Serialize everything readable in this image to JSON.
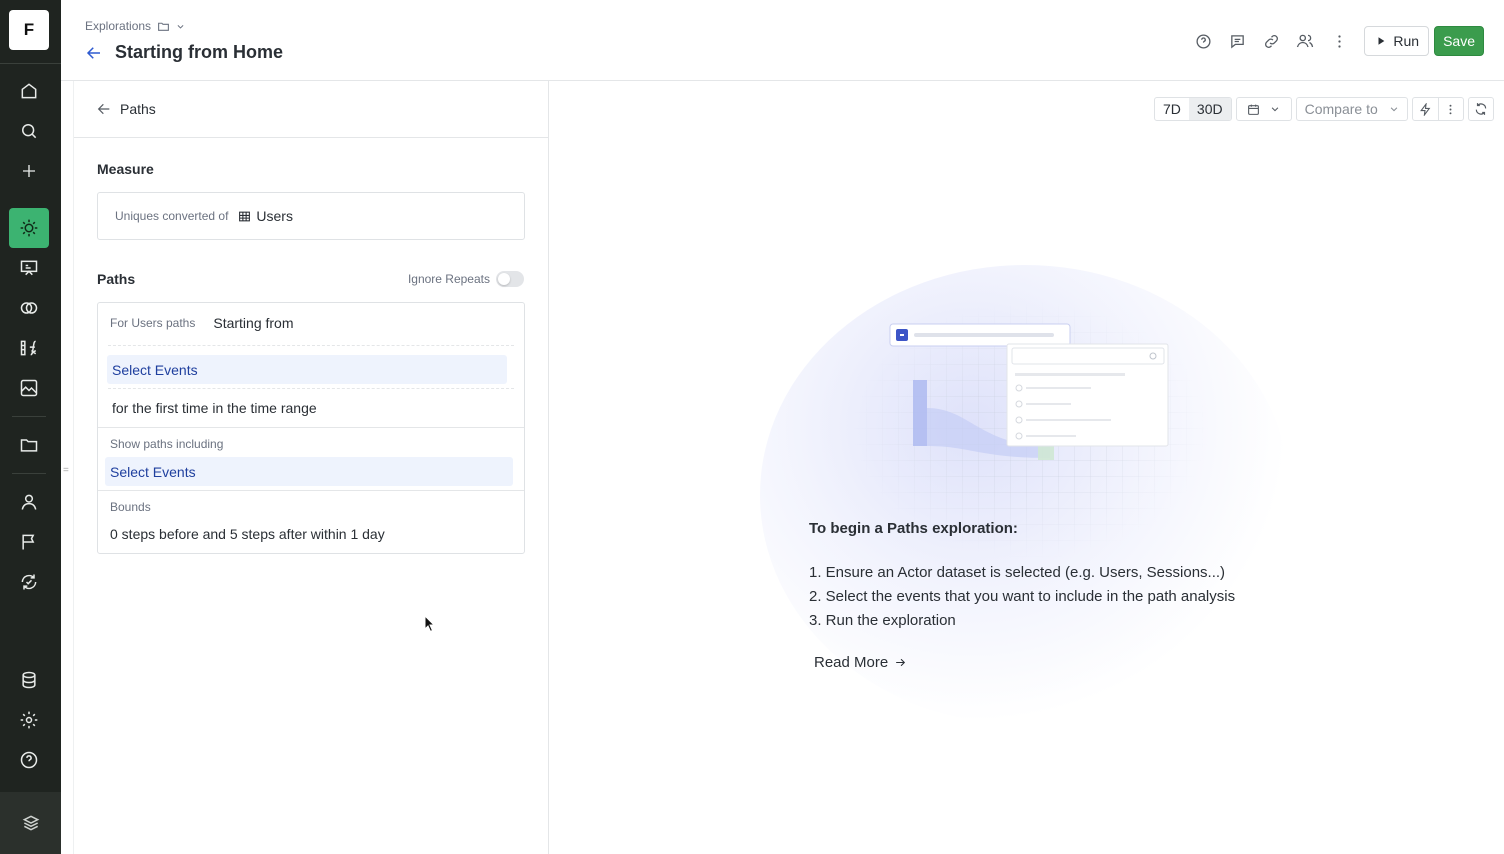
{
  "logo": {
    "letter": "F"
  },
  "sidebar": {
    "items": [
      {
        "name": "home-icon"
      },
      {
        "name": "search-icon"
      },
      {
        "name": "plus-icon"
      },
      {
        "name": "lightbulb-icon",
        "active": true
      },
      {
        "name": "presentation-icon"
      },
      {
        "name": "overlap-circles-icon"
      },
      {
        "name": "formula-icon"
      },
      {
        "name": "image-chart-icon"
      },
      {
        "name": "folder-icon"
      },
      {
        "name": "user-icon"
      },
      {
        "name": "flag-icon"
      },
      {
        "name": "experiment-icon"
      },
      {
        "name": "database-icon"
      },
      {
        "name": "gear-icon"
      },
      {
        "name": "help-icon"
      },
      {
        "name": "brand-stack-icon"
      }
    ],
    "accent": "#3cb371"
  },
  "header": {
    "breadcrumb": "Explorations",
    "title": "Starting from Home",
    "actions": {
      "run_label": "Run",
      "save_label": "Save"
    },
    "save_color": "#3b9c4d"
  },
  "panel": {
    "back_label": "Paths",
    "measure": {
      "heading": "Measure",
      "prefix": "Uniques converted of",
      "dataset": "Users"
    },
    "paths": {
      "heading": "Paths",
      "ignore_repeats_label": "Ignore Repeats",
      "ignore_repeats_on": false,
      "for_label": "For Users paths",
      "starting_label": "Starting from",
      "select_events_1": "Select Events",
      "first_time_text": "for the first time in the time range",
      "show_paths_label": "Show paths including",
      "select_events_2": "Select Events",
      "bounds_label": "Bounds",
      "bounds_text": "0 steps before and 5 steps after within 1 day"
    }
  },
  "toolbar": {
    "range_7d": "7D",
    "range_30d": "30D",
    "selected_range": "30D",
    "compare_placeholder": "Compare to"
  },
  "empty_state": {
    "title": "To begin a Paths exploration:",
    "steps": [
      "1. Ensure an Actor dataset is selected (e.g. Users, Sessions...)",
      "2. Select the events that you want to include in the path analysis",
      "3. Run the exploration"
    ],
    "read_more": "Read More"
  }
}
